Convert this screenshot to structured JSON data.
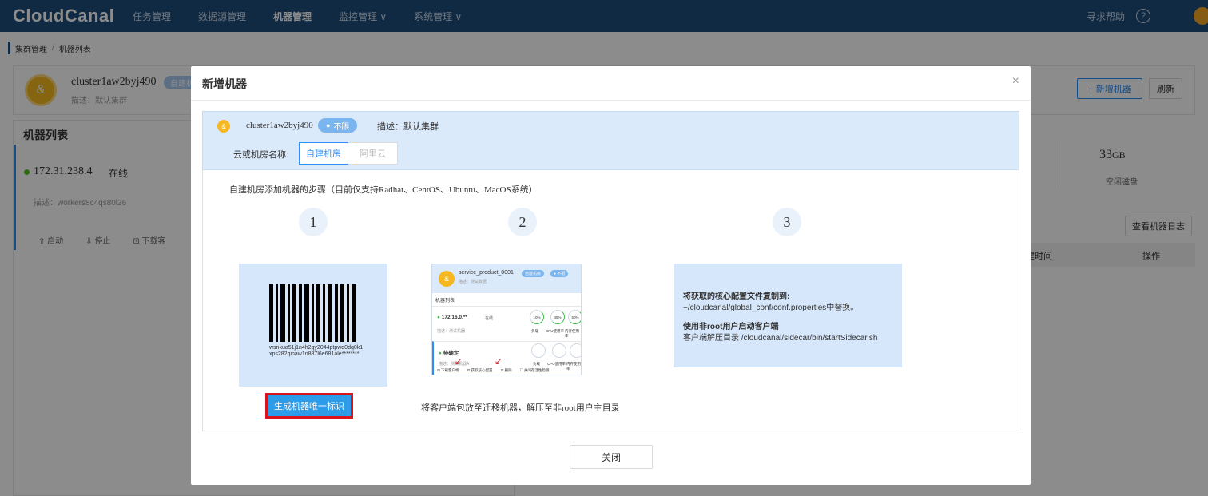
{
  "nav": {
    "logo": "CloudCanal",
    "items": [
      "任务管理",
      "数据源管理",
      "机器管理",
      "监控管理 ∨",
      "系统管理 ∨"
    ],
    "help": "寻求帮助",
    "help_icon": "?"
  },
  "breadcrumb": {
    "parent": "集群管理",
    "separator": "/",
    "current": "机器列表"
  },
  "cluster": {
    "name": "cluster1aw2byj490",
    "tag": "自建机",
    "desc": "描述：默认集群"
  },
  "toolbar": {
    "add_machine": "+ 新增机器",
    "refresh": "刷新"
  },
  "machine_list": {
    "title": "机器列表",
    "ip": "172.31.238.4",
    "status": "在线",
    "desc": "描述：workers8c4qs80l26",
    "actions": [
      "⇧ 启动",
      "⇩ 停止",
      "⊡ 下载客"
    ]
  },
  "disk": {
    "value": "33",
    "unit": "GB",
    "label": "空闲磁盘"
  },
  "log_button": "查看机器日志",
  "table_headers": {
    "time": "建时间",
    "op": "操作"
  },
  "modal": {
    "title": "新增机器",
    "close_icon": "×",
    "info": {
      "cluster_name": "cluster1aw2byj490",
      "tag": "不限",
      "desc": "描述：默认集群",
      "room_label": "云或机房名称:",
      "room_tabs": [
        "自建机房",
        "阿里云"
      ]
    },
    "steps_title": "自建机房添加机器的步骤（目前仅支持Radhat、CentOS、Ubuntu、MacOS系统）",
    "step_numbers": [
      "1",
      "2",
      "3"
    ],
    "step1": {
      "barcode_text": "wsnkua51j1n4h2qy2044ptpwq0dq0k1xps282qinaw1n887l6e681ale********",
      "button": "生成机器唯一标识"
    },
    "step2": {
      "mock": {
        "name": "service_product_0001",
        "pill1": "自建机房",
        "pill2": "● 不限",
        "sub": "描述：测试数据",
        "list_title": "机器列表",
        "row1_ip": "172.16.0.**",
        "row1_status": "在线",
        "row1_desc": "描述：测试机器",
        "row1_vals": [
          "10%",
          "45%",
          "50%"
        ],
        "labels": [
          "负载",
          "CPU使用率",
          "内存使用率"
        ],
        "row2_ip": "待确定",
        "row2_desc": "描述：测试机器A",
        "footer": [
          "⊡ 下载客户端",
          "⊡ 获取核心配置",
          "⊡ 删除",
          "☐ 关闭存活性检测"
        ]
      },
      "caption": "将客户端包放至迁移机器，解压至非root用户主目录"
    },
    "step3": {
      "line1": "将获取的核心配置文件复制到:",
      "line2": "~/cloudcanal/global_conf/conf.properties中替换。",
      "line3": "使用非root用户启动客户端",
      "line4": "客户端解压目录 /cloudcanal/sidecar/bin/startSidecar.sh"
    },
    "close_button": "关闭"
  }
}
